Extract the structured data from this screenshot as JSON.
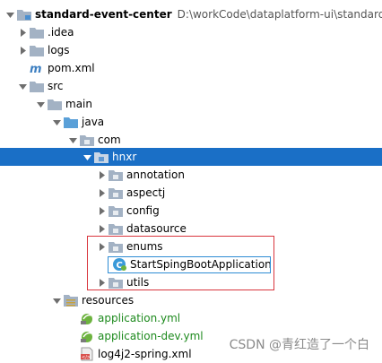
{
  "tree": {
    "root": {
      "label": "standard-event-center",
      "path": "D:\\workCode\\dataplatform-ui\\standard-e"
    },
    "idea": {
      "label": ".idea"
    },
    "logs": {
      "label": "logs"
    },
    "pom": {
      "label": "pom.xml"
    },
    "src": {
      "label": "src"
    },
    "main": {
      "label": "main"
    },
    "java": {
      "label": "java"
    },
    "com": {
      "label": "com"
    },
    "hnxr": {
      "label": "hnxr"
    },
    "annotation": {
      "label": "annotation"
    },
    "aspectj": {
      "label": "aspectj"
    },
    "config": {
      "label": "config"
    },
    "datasource": {
      "label": "datasource"
    },
    "enums": {
      "label": "enums"
    },
    "app_class": {
      "label": "StartSpingBootApplication"
    },
    "utils": {
      "label": "utils"
    },
    "resources": {
      "label": "resources"
    },
    "app_yml": {
      "label": "application.yml"
    },
    "app_dev_yml": {
      "label": "application-dev.yml"
    },
    "log4j2": {
      "label": "log4j2-spring.xml"
    }
  },
  "watermark": "CSDN @青红造了一个白",
  "colors": {
    "selection": "#1a6fc6",
    "folder": "#a3b2c4",
    "source_folder": "#5aa0d8",
    "resource_file_text": "#1d8a1d",
    "highlight_border": "#d9363e"
  }
}
